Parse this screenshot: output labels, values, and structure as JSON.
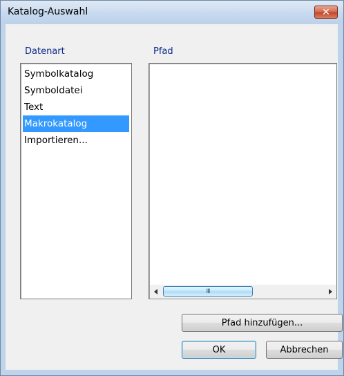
{
  "window": {
    "title": "Katalog-Auswahl",
    "close_glyph": "✕"
  },
  "datenart": {
    "label": "Datenart",
    "items": [
      {
        "label": "Symbolkatalog",
        "selected": false
      },
      {
        "label": "Symboldatei",
        "selected": false
      },
      {
        "label": "Text",
        "selected": false
      },
      {
        "label": "Makrokatalog",
        "selected": true
      },
      {
        "label": "Importieren...",
        "selected": false
      }
    ]
  },
  "pfad": {
    "label": "Pfad",
    "items": [],
    "scroll_grip": "III"
  },
  "buttons": {
    "add_path": "Pfad hinzufügen...",
    "ok": "OK",
    "cancel": "Abbrechen"
  },
  "icons": {
    "close": "close-icon",
    "scroll_left": "arrow-left-icon",
    "scroll_right": "arrow-right-icon"
  },
  "colors": {
    "selection": "#3399ff",
    "label_blue": "#0b2a8c",
    "close_red": "#c0452a"
  }
}
